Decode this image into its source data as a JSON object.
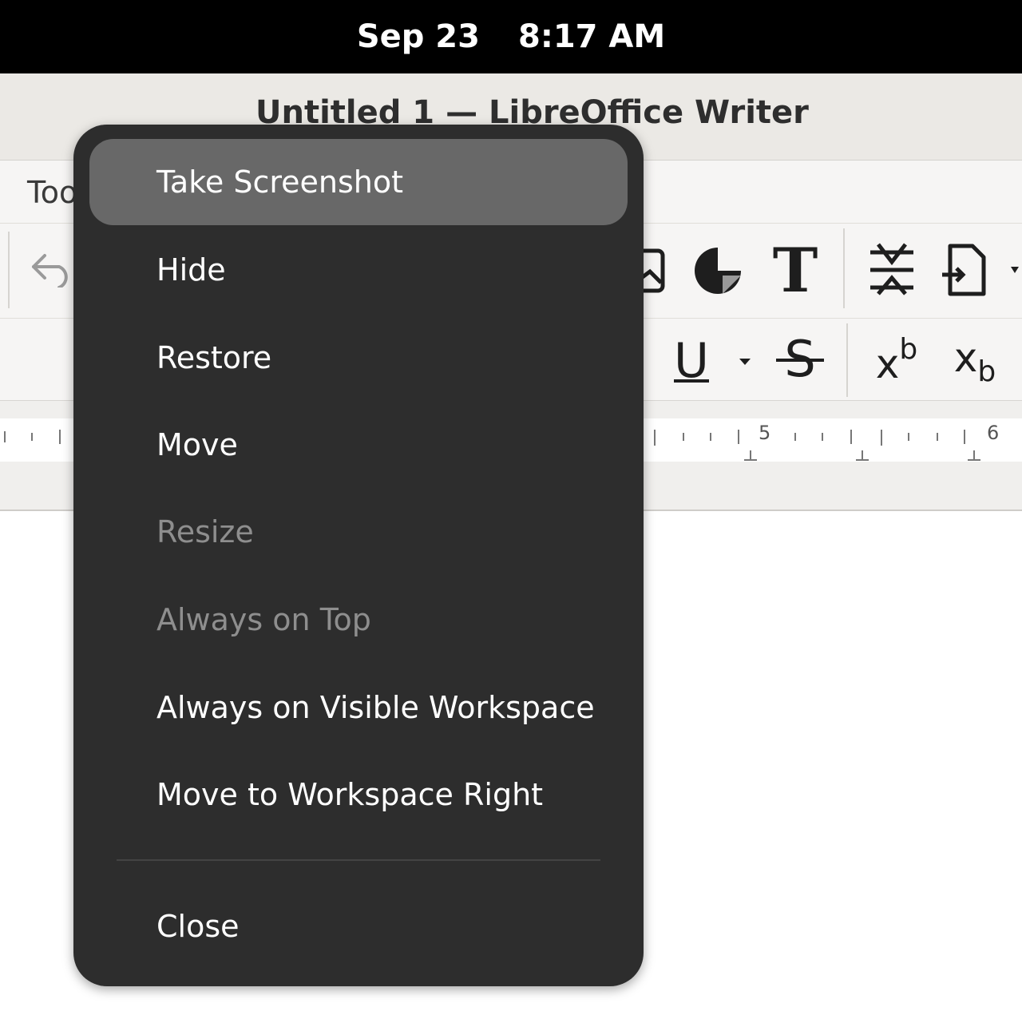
{
  "topbar": {
    "date": "Sep 23",
    "time": "8:17 AM"
  },
  "window": {
    "title": "Untitled 1 — LibreOffice Writer"
  },
  "menubar": {
    "partial_item": "Too"
  },
  "toolbar": {
    "icons": [
      "undo-icon",
      "image-icon",
      "chart-icon",
      "text-box-icon",
      "page-break-icon",
      "field-icon"
    ],
    "text_box_glyph": "T"
  },
  "format_toolbar": {
    "underline_glyph": "U",
    "strike_glyph": "S",
    "superscript_base": "x",
    "superscript_exp": "b",
    "subscript_base": "x",
    "subscript_sub": "b"
  },
  "ruler": {
    "labels": [
      "5",
      "6"
    ]
  },
  "context_menu": {
    "items": [
      {
        "label": "Take Screenshot",
        "state": "highlighted"
      },
      {
        "label": "Hide",
        "state": "enabled"
      },
      {
        "label": "Restore",
        "state": "enabled"
      },
      {
        "label": "Move",
        "state": "enabled"
      },
      {
        "label": "Resize",
        "state": "disabled"
      },
      {
        "label": "Always on Top",
        "state": "disabled"
      },
      {
        "label": "Always on Visible Workspace",
        "state": "enabled"
      },
      {
        "label": "Move to Workspace Right",
        "state": "enabled"
      }
    ],
    "close_label": "Close"
  }
}
